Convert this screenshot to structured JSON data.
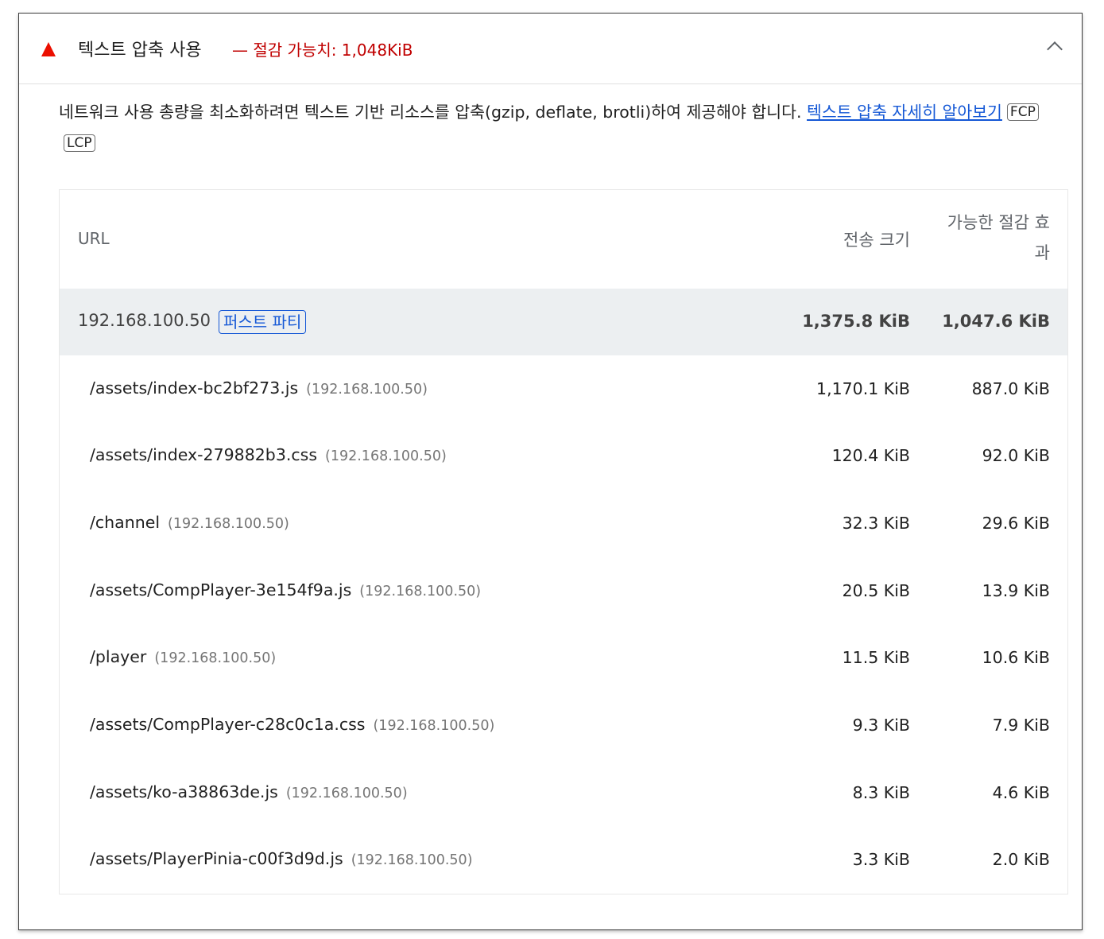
{
  "audit": {
    "title": "텍스트 압축 사용",
    "savings_text": "— 절감 가능치: 1,048KiB",
    "description": "네트워크 사용 총량을 최소화하려면 텍스트 기반 리소스를 압축(gzip, deflate, brotli)하여 제공해야 합니다. ",
    "learn_more": "텍스트 압축 자세히 알아보기",
    "metrics": [
      "FCP",
      "LCP"
    ],
    "status_color": "#eb0f00"
  },
  "table": {
    "headers": {
      "url": "URL",
      "transfer_size": "전송 크기",
      "potential_savings": "가능한 절감 효과"
    },
    "group": {
      "host": "192.168.100.50",
      "badge": "퍼스트 파티",
      "transfer_size": "1,375.8 KiB",
      "potential_savings": "1,047.6 KiB"
    },
    "rows": [
      {
        "url": "/assets/index-bc2bf273.js",
        "host": "(192.168.100.50)",
        "transfer_size": "1,170.1 KiB",
        "potential_savings": "887.0 KiB"
      },
      {
        "url": "/assets/index-279882b3.css",
        "host": "(192.168.100.50)",
        "transfer_size": "120.4 KiB",
        "potential_savings": "92.0 KiB"
      },
      {
        "url": "/channel",
        "host": "(192.168.100.50)",
        "transfer_size": "32.3 KiB",
        "potential_savings": "29.6 KiB"
      },
      {
        "url": "/assets/CompPlayer-3e154f9a.js",
        "host": "(192.168.100.50)",
        "transfer_size": "20.5 KiB",
        "potential_savings": "13.9 KiB"
      },
      {
        "url": "/player",
        "host": "(192.168.100.50)",
        "transfer_size": "11.5 KiB",
        "potential_savings": "10.6 KiB"
      },
      {
        "url": "/assets/CompPlayer-c28c0c1a.css",
        "host": "(192.168.100.50)",
        "transfer_size": "9.3 KiB",
        "potential_savings": "7.9 KiB"
      },
      {
        "url": "/assets/ko-a38863de.js",
        "host": "(192.168.100.50)",
        "transfer_size": "8.3 KiB",
        "potential_savings": "4.6 KiB"
      },
      {
        "url": "/assets/PlayerPinia-c00f3d9d.js",
        "host": "(192.168.100.50)",
        "transfer_size": "3.3 KiB",
        "potential_savings": "2.0 KiB"
      }
    ]
  }
}
